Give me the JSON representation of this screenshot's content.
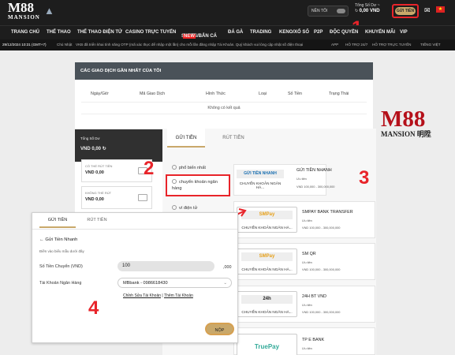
{
  "header": {
    "logo_text": "M88",
    "logo_sub": "MANSION",
    "dark_mode_label": "NỀN TỐI",
    "balance_label": "Tổng Số Dư ~",
    "balance_value": "0,00 VND",
    "deposit_button": "GỬI TIỀN",
    "mail_icon": "mail-icon",
    "flag": "VN"
  },
  "menu": [
    "TRANG CHỦ",
    "THỂ THAO",
    "THỂ THAO ĐIỆN TỬ",
    "CASINO TRỰC TUYẾN",
    "SLOTS/BẮN CÁ",
    "ĐÁ GÀ",
    "TRADING",
    "KENO/XỔ SỐ",
    "P2P",
    "ĐỘC QUYỀN",
    "KHUYẾN MÃI",
    "VIP"
  ],
  "menu_hot_badge": "NEW",
  "ticker": {
    "datetime": "29/12/2024 10:31 (GMT+7)",
    "day": "Chủ Nhật",
    "message": "VKB đã triển khai tính năng OTP (mã xác thực để nhập một lần) cho mỗi lần đăng nhập Tài Khoản. Quý khách vui lòng cập nhật số điện thoại",
    "app": "APP",
    "chat": "HỖ TRỢ 24/7",
    "support": "HỖ TRỢ TRỰC TUYẾN",
    "lang": "TIẾNG VIỆT"
  },
  "transactions": {
    "title": "CÁC GIAO DỊCH GẦN NHẤT CỦA TÔI",
    "columns": [
      "Ngày/Giờ",
      "Mã Giao Dịch",
      "Hình Thức",
      "Loại",
      "Số Tiền",
      "Trạng Thái"
    ],
    "empty": "Không có kết quả"
  },
  "watermark": {
    "big": "M88",
    "small": "MANSION 明陞"
  },
  "side": {
    "total_label": "Tổng Số Dư",
    "total_value": "VND 0,00",
    "cards": [
      {
        "label": "CÓ THỂ RÚT TIỀN",
        "value": "VND 0,00"
      },
      {
        "label": "KHÔNG THỂ RÚT",
        "value": "VND 0,00"
      }
    ]
  },
  "deposit_panel": {
    "tabs": [
      "GỬI TIỀN",
      "RÚT TIỀN"
    ],
    "methods": [
      "phổ biến nhất",
      "chuyển khoản ngân hàng",
      "ví điện tử"
    ],
    "providers": [
      {
        "logo": "GỬI TIỀN NHANH",
        "bank": "CHUYỂN KHOẢN NGÂN HÀ...",
        "name": "GỬI TIỀN NHANH",
        "tag": "Ưu tiên",
        "range": "VND 100,000 - 300,000,000"
      },
      {
        "logo": "SMPay",
        "bank": "CHUYỂN KHOẢN NGÂN HÀ...",
        "name": "SMPAY BANK TRANSFER",
        "tag": "Ưu tiên",
        "range": "VND 100,000 - 300,000,000"
      },
      {
        "logo": "SMPay",
        "bank": "CHUYỂN KHOẢN NGÂN HÀ...",
        "name": "SM QR",
        "tag": "Ưu tiên",
        "range": "VND 100,000 - 300,000,000"
      },
      {
        "logo": "24h",
        "bank": "CHUYỂN KHOẢN NGÂN HÀ...",
        "name": "24H BT VND",
        "tag": "Ưu tiên",
        "range": "VND 100,000 - 300,000,000"
      },
      {
        "logo": "TruePay",
        "bank": "",
        "name": "TP E BANK",
        "tag": "Ưu tiên",
        "range": ""
      }
    ]
  },
  "modal": {
    "tabs": [
      "GỬI TIỀN",
      "RÚT TIỀN"
    ],
    "back_title": "Gửi Tiền Nhanh",
    "instruction": "Điền vào biểu mẫu dưới đây",
    "amount_label": "Số Tiền Chuyển (VND)",
    "amount_value": "100",
    "amount_suffix": ",000",
    "bank_label": "Tài Khoản Ngân Hàng",
    "bank_value": "MBbank - 0986618430",
    "edit_link": "Chỉnh Sửa Tài Khoản",
    "separator": "|",
    "add_link": "Thêm Tài Khoản",
    "submit": "NỘP"
  },
  "step_numbers": [
    "1",
    "2",
    "3",
    "4"
  ]
}
